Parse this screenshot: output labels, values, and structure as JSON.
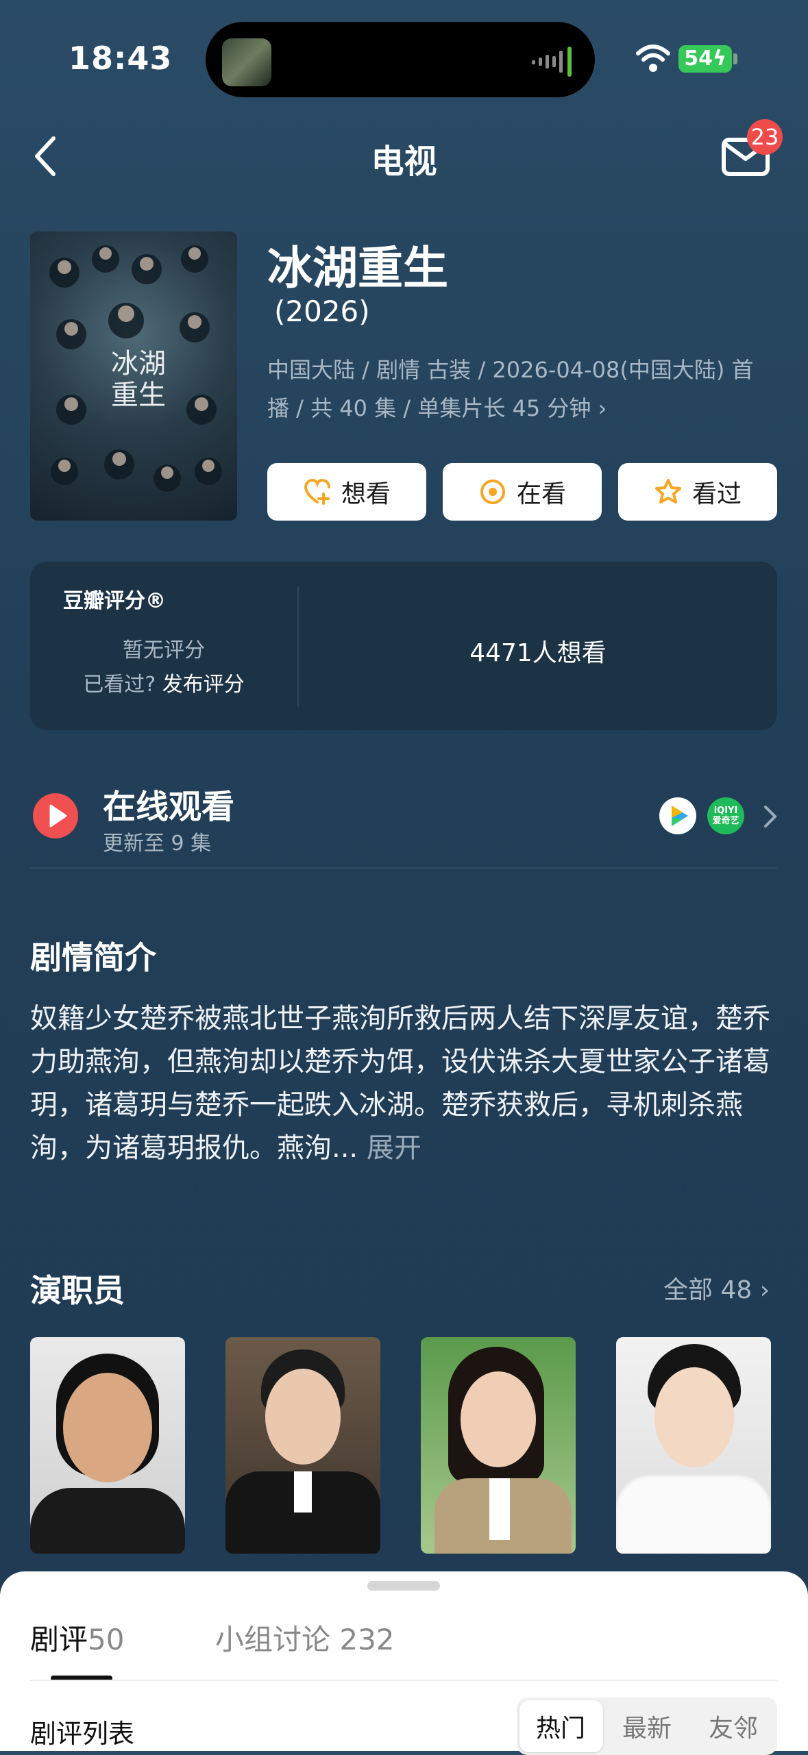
{
  "status": {
    "time": "18:43",
    "battery": "54"
  },
  "nav": {
    "title": "电视",
    "badge": "23"
  },
  "movie": {
    "title": "冰湖重生",
    "year": "(2026)",
    "meta": "中国大陆 / 剧情 古装 / 2026-04-08(中国大陆) 首播 / 共 40 集 / 单集片长 45 分钟",
    "poster_text": "冰湖重生"
  },
  "actions": [
    {
      "label": "想看",
      "icon": "heart-plus-icon"
    },
    {
      "label": "在看",
      "icon": "target-icon"
    },
    {
      "label": "看过",
      "icon": "star-icon"
    }
  ],
  "rating": {
    "title": "豆瓣评分®",
    "no_rating": "暂无评分",
    "seen_prefix": "已看过?",
    "seen_link": "发布评分",
    "want_count": "4471人想看"
  },
  "online": {
    "title": "在线观看",
    "subtitle": "更新至 9 集",
    "iqiyi_label": "爱奇艺"
  },
  "synopsis": {
    "title": "剧情简介",
    "text": "奴籍少女楚乔被燕北世子燕洵所救后两人结下深厚友谊，楚乔力助燕洵，但燕洵却以楚乔为饵，设伏诛杀大夏世家公子诸葛玥，诸葛玥与楚乔一起跌入冰湖。楚乔获救后，寻机刺杀燕洵，为诸葛玥报仇。燕洵...",
    "expand": "展开"
  },
  "cast": {
    "title": "演职员",
    "all": "全部 48"
  },
  "sheet": {
    "tab1_label": "剧评",
    "tab1_count": "50",
    "tab2": "小组讨论 232",
    "list_label": "剧评列表",
    "seg": [
      "热门",
      "最新",
      "友邻"
    ]
  },
  "colors": {
    "accent": "#f5a623",
    "play": "#f0504f",
    "badge": "#f04b4b"
  }
}
